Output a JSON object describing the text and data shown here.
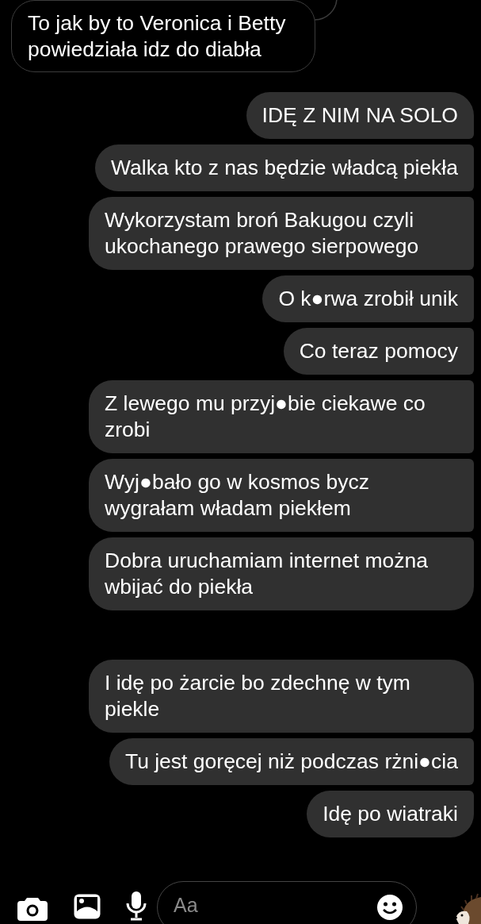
{
  "groups": [
    {
      "kind": "received",
      "messages": [
        "To jak by to Veronica i Betty powiedziała idz do diabła"
      ]
    },
    {
      "kind": "sent",
      "messages": [
        "IDĘ Z NIM NA SOLO",
        "Walka kto z nas będzie władcą piekła",
        "Wykorzystam broń Bakugou czyli ukochanego prawego sierpowego",
        "O k●rwa zrobił unik",
        "Co teraz pomocy",
        "Z lewego mu przyj●bie ciekawe co zrobi",
        "Wyj●bało go w kosmos bycz wygrałam władam piekłem",
        "Dobra uruchamiam internet można wbijać do piekła"
      ]
    },
    {
      "kind": "sent",
      "messages": [
        "I idę po żarcie bo zdechnę w tym piekle",
        "Tu jest goręcej niż podczas rżni●cia",
        "Idę po wiatraki"
      ]
    }
  ],
  "composer": {
    "placeholder": "Aa"
  }
}
